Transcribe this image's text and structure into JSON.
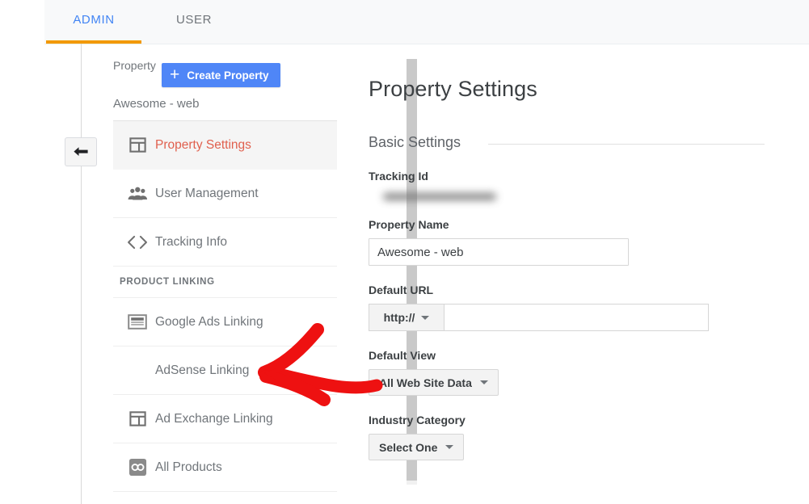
{
  "tabs": [
    {
      "label": "ADMIN",
      "active": true,
      "color": "#4285f4"
    },
    {
      "label": "USER",
      "active": false,
      "color": "#70757a"
    }
  ],
  "back_button": {
    "icon": "back-arrow-icon"
  },
  "nav": {
    "property_label": "Property",
    "create_button": {
      "label": "Create Property",
      "icon": "plus-icon",
      "color": "#4f86f7"
    },
    "account_name": "Awesome - web",
    "items": [
      {
        "label": "Property Settings",
        "icon": "property-settings-icon",
        "selected": true
      },
      {
        "label": "User Management",
        "icon": "people-icon",
        "selected": false
      },
      {
        "label": "Tracking Info",
        "icon": "code-brackets-icon",
        "selected": false
      }
    ],
    "section_title": "PRODUCT LINKING",
    "product_items": [
      {
        "label": "Google Ads Linking",
        "icon": "ads-card-icon",
        "selected": false
      },
      {
        "label": "AdSense Linking",
        "icon": "",
        "selected": false
      },
      {
        "label": "Ad Exchange Linking",
        "icon": "ad-exchange-icon",
        "selected": false
      },
      {
        "label": "All Products",
        "icon": "link-chain-icon",
        "selected": false
      }
    ],
    "selected_color": "#e0604e"
  },
  "content": {
    "title": "Property Settings",
    "section_label": "Basic Settings",
    "fields": {
      "tracking_id": {
        "label": "Tracking Id",
        "value": "",
        "redacted": true
      },
      "property_name": {
        "label": "Property Name",
        "value": "Awesome - web",
        "placeholder": ""
      },
      "default_url": {
        "label": "Default URL",
        "prefix": "http://",
        "value": "",
        "placeholder": ""
      },
      "default_view": {
        "label": "Default View",
        "value": "All Web Site Data"
      },
      "industry_category": {
        "label": "Industry Category",
        "value": "Select One"
      }
    }
  },
  "annotation": {
    "type": "arrow",
    "color": "#ee1111",
    "points_at": "AdSense Linking"
  }
}
